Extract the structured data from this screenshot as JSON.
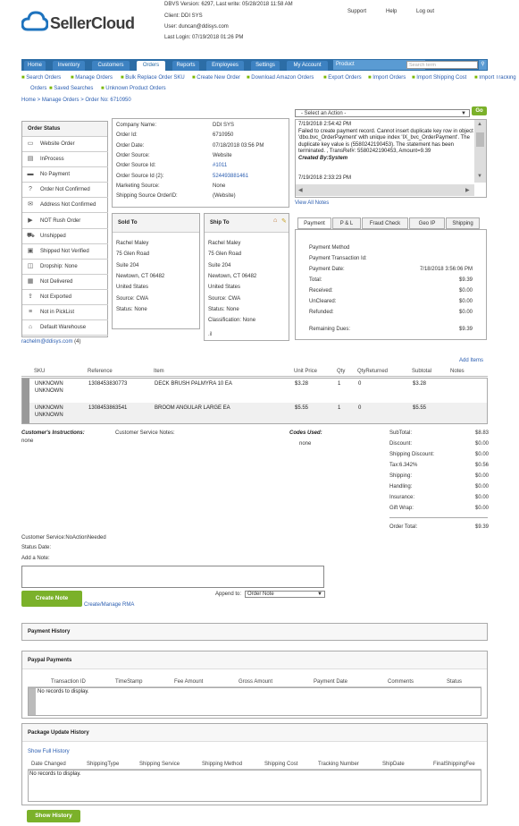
{
  "header": {
    "logo_text": "SellerCloud",
    "version_line": "DBVS Version: 6297, Last write: 05/28/2018 11:58 AM",
    "client_line": "Client: DDI SYS",
    "user_line": "User: duncan@ddisys.com",
    "login_line": "Last Login: 07/19/2018 01:26 PM",
    "links": [
      "Support",
      "Help",
      "Log out"
    ]
  },
  "nav": {
    "tabs": [
      "Home",
      "Inventory",
      "Customers",
      "Orders",
      "Reports",
      "Employees",
      "Settings",
      "My Account"
    ],
    "active": "Orders",
    "product_select": "Product",
    "search_placeholder": "Search term"
  },
  "subnav": {
    "row1": [
      "Search Orders",
      "Manage Orders",
      "Bulk Replace Order SKU",
      "Create New Order",
      "Download Amazon Orders",
      "Export Orders",
      "Import Orders",
      "Import Shipping Cost",
      "Import Tracking"
    ],
    "row2": [
      "Orders",
      "Saved Searches",
      "Unknown Product Orders"
    ]
  },
  "breadcrumb": "Home > Manage Orders > Order No: 6710950",
  "order_status": {
    "title": "Order Status",
    "items": [
      {
        "label": "Website Order",
        "icon": "monitor-icon"
      },
      {
        "label": "InProcess",
        "icon": "document-icon"
      },
      {
        "label": "No Payment",
        "icon": "credit-card-icon"
      },
      {
        "label": "Order Not Confirmed",
        "icon": "question-icon"
      },
      {
        "label": "Address Not Confirmed",
        "icon": "envelope-icon"
      },
      {
        "label": "NOT Rush Order",
        "icon": "arrow-icon"
      },
      {
        "label": "Unshipped",
        "icon": "truck-icon"
      },
      {
        "label": "Shipped Not Verified",
        "icon": "box-icon"
      },
      {
        "label": "Dropship: None",
        "icon": "dropship-icon"
      },
      {
        "label": "Not Delivered",
        "icon": "package-icon"
      },
      {
        "label": "Not Exported",
        "icon": "export-icon"
      },
      {
        "label": "Not in PickList",
        "icon": "list-icon"
      },
      {
        "label": "Default Warehouse",
        "icon": "warehouse-icon"
      }
    ],
    "email": "rachelm@ddisys.com",
    "count": "(4)"
  },
  "order_info": {
    "rows": [
      {
        "label": "Company Name:",
        "value": "DDI SYS"
      },
      {
        "label": "Order Id:",
        "value": "6710950"
      },
      {
        "label": "Order Date:",
        "value": "07/18/2018 03:56 PM"
      },
      {
        "label": "Order Source:",
        "value": "Website"
      },
      {
        "label": "Order Source Id:",
        "value": "#1011"
      },
      {
        "label": "Order Source Id (2):",
        "value": "524493881461"
      },
      {
        "label": "Marketing Source:",
        "value": "None"
      },
      {
        "label": "Shipping Source OrderID:",
        "value": "(Website)"
      }
    ]
  },
  "actions": {
    "select": "- Select an Action -",
    "go": "Go"
  },
  "log": {
    "entries": [
      {
        "time": "7/19/2018 2:54:42 PM",
        "text": "Failed to create payment record. Cannot insert duplicate key row in object 'dbo.bvc_OrderPayment' with unique index 'IX_bvc_OrderPayment'. The duplicate key value is (5580242190453). The statement has been terminated. , TransRef#: 5580242190453, Amount=9.39",
        "by": "Created By:System"
      },
      {
        "time": "7/19/2018 2:33:23 PM",
        "text": ""
      }
    ],
    "view_all": "View All Notes"
  },
  "sold_to": {
    "title": "Sold To",
    "lines": [
      "Rachel Maley",
      "75 Glen Road",
      "Suite 204",
      "Newtown, CT 06482",
      "United States",
      "Source: CWA",
      "Status: None"
    ]
  },
  "ship_to": {
    "title": "Ship To",
    "lines": [
      "Rachel Maley",
      "75 Glen Road",
      "Suite 204",
      "Newtown, CT 06482",
      "United States",
      "Source: CWA",
      "Status: None",
      "Classification: None"
    ]
  },
  "payment_tabs": [
    "Payment",
    "P & L",
    "Fraud Check",
    "Geo IP",
    "Shipping"
  ],
  "payment": {
    "rows": [
      {
        "label": "Payment Method",
        "value": ""
      },
      {
        "label": "Payment Transaction Id:",
        "value": ""
      },
      {
        "label": "Payment Date:",
        "value": "7/18/2018 3:56:06 PM"
      },
      {
        "label": "Total:",
        "value": "$9.39"
      },
      {
        "label": "Received:",
        "value": "$0.00"
      },
      {
        "label": "UnCleared:",
        "value": "$0.00"
      },
      {
        "label": "Refunded:",
        "value": "$0.00"
      },
      {
        "label": "Remaining Dues:",
        "value": "$9.39"
      }
    ],
    "add_items": "Add Items"
  },
  "items_table": {
    "headers": [
      "SKU",
      "Reference",
      "Item",
      "Unit Price",
      "Qty",
      "QtyReturned",
      "Subtotal",
      "Notes"
    ],
    "rows": [
      {
        "sku": "UNKNOWN UNKNOWN",
        "ref": "1308453830773",
        "item": "DECK BRUSH PALMYRA 10 EA",
        "price": "$3.28",
        "qty": "1",
        "ret": "0",
        "sub": "$3.28"
      },
      {
        "sku": "UNKNOWN UNKNOWN",
        "ref": "1308453863541",
        "item": "BROOM ANGULAR LARGE EA",
        "price": "$5.55",
        "qty": "1",
        "ret": "0",
        "sub": "$5.55"
      }
    ]
  },
  "notes": {
    "customer_instructions_label": "Customer's Instructions:",
    "customer_instructions": "none",
    "cs_notes_label": "Customer Service Notes:",
    "codes_label": "Codes Used:",
    "codes": "none"
  },
  "totals": [
    {
      "label": "SubTotal:",
      "value": "$8.83"
    },
    {
      "label": "Discount:",
      "value": "$0.00"
    },
    {
      "label": "Shipping Discount:",
      "value": "$0.00"
    },
    {
      "label": "Tax:6.342%",
      "value": "$0.56"
    },
    {
      "label": "Shipping:",
      "value": "$0.00"
    },
    {
      "label": "Handling:",
      "value": "$0.00"
    },
    {
      "label": "Insurance:",
      "value": "$0.00"
    },
    {
      "label": "Gift Wrap:",
      "value": "$0.00"
    },
    {
      "label": "Order Total:",
      "value": "$9.39"
    }
  ],
  "footer_info": {
    "cs_line": "Customer Service:NoActionNeeded",
    "status_date": "Status Date:",
    "add_note": "Add a Note:",
    "create_note": "Create Note",
    "append_to": "Append to:",
    "append_select": "Order Note",
    "rma_link": "Create/Manage RMA"
  },
  "payment_history": {
    "title": "Payment History"
  },
  "paypal": {
    "title": "Paypal Payments",
    "headers": [
      "Transaction ID",
      "TimeStamp",
      "Fee Amount",
      "Gross Amount",
      "Payment Date",
      "Comments",
      "Status"
    ],
    "empty": "No records to display."
  },
  "package_history": {
    "title": "Package Update History",
    "show_full": "Show Full History",
    "headers": [
      "Date Changed",
      "ShippingType",
      "Shipping Service",
      "Shipping Method",
      "Shipping Cost",
      "Tracking Number",
      "ShipDate",
      "FinalShippingFee"
    ],
    "empty": "No records to display."
  },
  "show_history": "Show History"
}
